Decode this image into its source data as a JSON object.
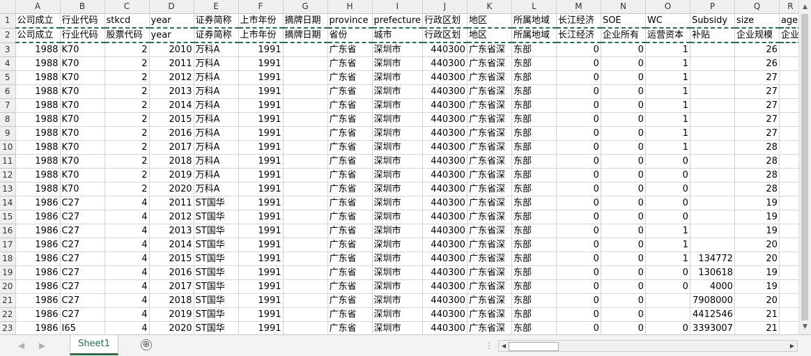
{
  "columns": [
    "A",
    "B",
    "C",
    "D",
    "E",
    "F",
    "G",
    "H",
    "I",
    "J",
    "K",
    "L",
    "M",
    "N",
    "O",
    "P",
    "Q",
    "R"
  ],
  "row1": [
    "公司成立",
    "行业代码",
    "stkcd",
    "year",
    "证券简称",
    "上市年份",
    "摘牌日期",
    "province",
    "prefecture",
    "行政区划",
    "地区",
    "所属地域",
    "长江经济",
    "SOE",
    "WC",
    "Subsidy",
    "size",
    "age"
  ],
  "row2": [
    "公司成立",
    "行业代码",
    "股票代码",
    "year",
    "证券简称",
    "上市年份",
    "摘牌日期",
    "省份",
    "城市",
    "行政区划",
    "地区",
    "所属地域",
    "长江经济",
    "企业所有",
    "运营资本",
    "补贴",
    "企业规模",
    "企业"
  ],
  "rows": [
    {
      "n": "3",
      "A": "1988",
      "B": "K70",
      "C": "2",
      "D": "2010",
      "E": "万科A",
      "F": "1991",
      "G": "",
      "H": "广东省",
      "I": "深圳市",
      "J": "440300",
      "K": "广东省深",
      "L": "东部",
      "M": "0",
      "N": "0",
      "O": "1",
      "P": "",
      "Q": "26"
    },
    {
      "n": "4",
      "A": "1988",
      "B": "K70",
      "C": "2",
      "D": "2011",
      "E": "万科A",
      "F": "1991",
      "G": "",
      "H": "广东省",
      "I": "深圳市",
      "J": "440300",
      "K": "广东省深",
      "L": "东部",
      "M": "0",
      "N": "0",
      "O": "1",
      "P": "",
      "Q": "26"
    },
    {
      "n": "5",
      "A": "1988",
      "B": "K70",
      "C": "2",
      "D": "2012",
      "E": "万科A",
      "F": "1991",
      "G": "",
      "H": "广东省",
      "I": "深圳市",
      "J": "440300",
      "K": "广东省深",
      "L": "东部",
      "M": "0",
      "N": "0",
      "O": "1",
      "P": "",
      "Q": "27"
    },
    {
      "n": "6",
      "A": "1988",
      "B": "K70",
      "C": "2",
      "D": "2013",
      "E": "万科A",
      "F": "1991",
      "G": "",
      "H": "广东省",
      "I": "深圳市",
      "J": "440300",
      "K": "广东省深",
      "L": "东部",
      "M": "0",
      "N": "0",
      "O": "1",
      "P": "",
      "Q": "27"
    },
    {
      "n": "7",
      "A": "1988",
      "B": "K70",
      "C": "2",
      "D": "2014",
      "E": "万科A",
      "F": "1991",
      "G": "",
      "H": "广东省",
      "I": "深圳市",
      "J": "440300",
      "K": "广东省深",
      "L": "东部",
      "M": "0",
      "N": "0",
      "O": "1",
      "P": "",
      "Q": "27"
    },
    {
      "n": "8",
      "A": "1988",
      "B": "K70",
      "C": "2",
      "D": "2015",
      "E": "万科A",
      "F": "1991",
      "G": "",
      "H": "广东省",
      "I": "深圳市",
      "J": "440300",
      "K": "广东省深",
      "L": "东部",
      "M": "0",
      "N": "0",
      "O": "1",
      "P": "",
      "Q": "27"
    },
    {
      "n": "9",
      "A": "1988",
      "B": "K70",
      "C": "2",
      "D": "2016",
      "E": "万科A",
      "F": "1991",
      "G": "",
      "H": "广东省",
      "I": "深圳市",
      "J": "440300",
      "K": "广东省深",
      "L": "东部",
      "M": "0",
      "N": "0",
      "O": "1",
      "P": "",
      "Q": "27"
    },
    {
      "n": "10",
      "A": "1988",
      "B": "K70",
      "C": "2",
      "D": "2017",
      "E": "万科A",
      "F": "1991",
      "G": "",
      "H": "广东省",
      "I": "深圳市",
      "J": "440300",
      "K": "广东省深",
      "L": "东部",
      "M": "0",
      "N": "0",
      "O": "1",
      "P": "",
      "Q": "28"
    },
    {
      "n": "11",
      "A": "1988",
      "B": "K70",
      "C": "2",
      "D": "2018",
      "E": "万科A",
      "F": "1991",
      "G": "",
      "H": "广东省",
      "I": "深圳市",
      "J": "440300",
      "K": "广东省深",
      "L": "东部",
      "M": "0",
      "N": "0",
      "O": "0",
      "P": "",
      "Q": "28"
    },
    {
      "n": "12",
      "A": "1988",
      "B": "K70",
      "C": "2",
      "D": "2019",
      "E": "万科A",
      "F": "1991",
      "G": "",
      "H": "广东省",
      "I": "深圳市",
      "J": "440300",
      "K": "广东省深",
      "L": "东部",
      "M": "0",
      "N": "0",
      "O": "0",
      "P": "",
      "Q": "28"
    },
    {
      "n": "13",
      "A": "1988",
      "B": "K70",
      "C": "2",
      "D": "2020",
      "E": "万科A",
      "F": "1991",
      "G": "",
      "H": "广东省",
      "I": "深圳市",
      "J": "440300",
      "K": "广东省深",
      "L": "东部",
      "M": "0",
      "N": "0",
      "O": "0",
      "P": "",
      "Q": "28"
    },
    {
      "n": "14",
      "A": "1986",
      "B": "C27",
      "C": "4",
      "D": "2011",
      "E": "ST国华",
      "F": "1991",
      "G": "",
      "H": "广东省",
      "I": "深圳市",
      "J": "440300",
      "K": "广东省深",
      "L": "东部",
      "M": "0",
      "N": "0",
      "O": "0",
      "P": "",
      "Q": "19"
    },
    {
      "n": "15",
      "A": "1986",
      "B": "C27",
      "C": "4",
      "D": "2012",
      "E": "ST国华",
      "F": "1991",
      "G": "",
      "H": "广东省",
      "I": "深圳市",
      "J": "440300",
      "K": "广东省深",
      "L": "东部",
      "M": "0",
      "N": "0",
      "O": "0",
      "P": "",
      "Q": "19"
    },
    {
      "n": "16",
      "A": "1986",
      "B": "C27",
      "C": "4",
      "D": "2013",
      "E": "ST国华",
      "F": "1991",
      "G": "",
      "H": "广东省",
      "I": "深圳市",
      "J": "440300",
      "K": "广东省深",
      "L": "东部",
      "M": "0",
      "N": "0",
      "O": "1",
      "P": "",
      "Q": "19"
    },
    {
      "n": "17",
      "A": "1986",
      "B": "C27",
      "C": "4",
      "D": "2014",
      "E": "ST国华",
      "F": "1991",
      "G": "",
      "H": "广东省",
      "I": "深圳市",
      "J": "440300",
      "K": "广东省深",
      "L": "东部",
      "M": "0",
      "N": "0",
      "O": "1",
      "P": "",
      "Q": "20"
    },
    {
      "n": "18",
      "A": "1986",
      "B": "C27",
      "C": "4",
      "D": "2015",
      "E": "ST国华",
      "F": "1991",
      "G": "",
      "H": "广东省",
      "I": "深圳市",
      "J": "440300",
      "K": "广东省深",
      "L": "东部",
      "M": "0",
      "N": "0",
      "O": "1",
      "P": "134772",
      "Q": "20"
    },
    {
      "n": "19",
      "A": "1986",
      "B": "C27",
      "C": "4",
      "D": "2016",
      "E": "ST国华",
      "F": "1991",
      "G": "",
      "H": "广东省",
      "I": "深圳市",
      "J": "440300",
      "K": "广东省深",
      "L": "东部",
      "M": "0",
      "N": "0",
      "O": "0",
      "P": "130618",
      "Q": "19"
    },
    {
      "n": "20",
      "A": "1986",
      "B": "C27",
      "C": "4",
      "D": "2017",
      "E": "ST国华",
      "F": "1991",
      "G": "",
      "H": "广东省",
      "I": "深圳市",
      "J": "440300",
      "K": "广东省深",
      "L": "东部",
      "M": "0",
      "N": "0",
      "O": "0",
      "P": "4000",
      "Q": "19"
    },
    {
      "n": "21",
      "A": "1986",
      "B": "C27",
      "C": "4",
      "D": "2018",
      "E": "ST国华",
      "F": "1991",
      "G": "",
      "H": "广东省",
      "I": "深圳市",
      "J": "440300",
      "K": "广东省深",
      "L": "东部",
      "M": "0",
      "N": "0",
      "O": "",
      "P": "7908000",
      "Q": "20"
    },
    {
      "n": "22",
      "A": "1986",
      "B": "C27",
      "C": "4",
      "D": "2019",
      "E": "ST国华",
      "F": "1991",
      "G": "",
      "H": "广东省",
      "I": "深圳市",
      "J": "440300",
      "K": "广东省深",
      "L": "东部",
      "M": "0",
      "N": "0",
      "O": "",
      "P": "4412546",
      "Q": "21"
    },
    {
      "n": "23",
      "A": "1986",
      "B": "I65",
      "C": "4",
      "D": "2020",
      "E": "ST国华",
      "F": "1991",
      "G": "",
      "H": "广东省",
      "I": "深圳市",
      "J": "440300",
      "K": "广东省深",
      "L": "东部",
      "M": "0",
      "N": "0",
      "O": "0",
      "P": "3393007",
      "Q": "21"
    }
  ],
  "sheet_tab": "Sheet1",
  "add_sheet_glyph": "⊕",
  "nav_left": "◀",
  "nav_right": "▶",
  "dots": "⋮",
  "scroll_up": "▲",
  "scroll_down": "▼",
  "accent_color": "#217346"
}
